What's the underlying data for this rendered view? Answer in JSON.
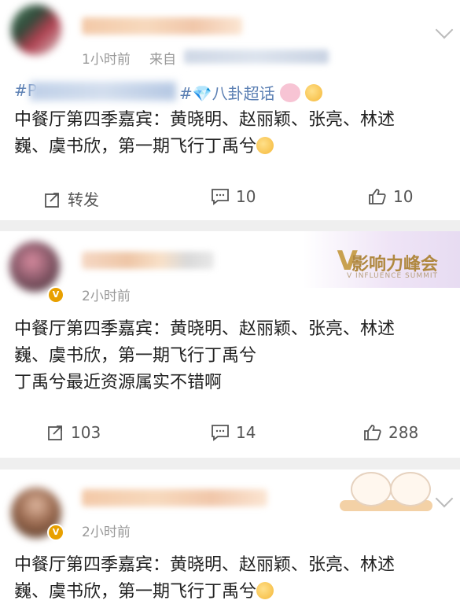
{
  "posts": [
    {
      "time": "1小时前",
      "source_prefix": "来自",
      "tag_start": "#P",
      "topic": "#💎八卦超话",
      "content": "中餐厅第四季嘉宾：黄晓明、赵丽颖、张亮、林述",
      "content_line2": "巍、虞书欣，第一期飞行丁禹兮",
      "repost_label": "转发",
      "comments": "10",
      "likes": "10"
    },
    {
      "time": "2小时前",
      "badge": "V",
      "content": "中餐厅第四季嘉宾：黄晓明、赵丽颖、张亮、林述",
      "content_line2": "巍、虞书欣，第一期飞行丁禹兮",
      "content_line3": "丁禹兮最近资源属实不错啊",
      "reposts": "103",
      "comments": "14",
      "likes": "288",
      "decoration_mark": "V",
      "decoration_title": "影响力峰会",
      "decoration_subtitle": "V INFLUENCE SUMMIT"
    },
    {
      "time": "2小时前",
      "badge": "V",
      "content": "中餐厅第四季嘉宾：黄晓明、赵丽颖、张亮、林述",
      "content_line2": "巍、虞书欣，第一期飞行丁禹兮"
    }
  ],
  "icons": {
    "repost": "share-icon",
    "comment": "comment-icon",
    "like": "thumbs-up-icon",
    "more": "chevron-down-icon"
  },
  "colors": {
    "topic_link": "#5b7fb3",
    "muted_text": "#999999",
    "vip_badge": "#e8a000"
  }
}
